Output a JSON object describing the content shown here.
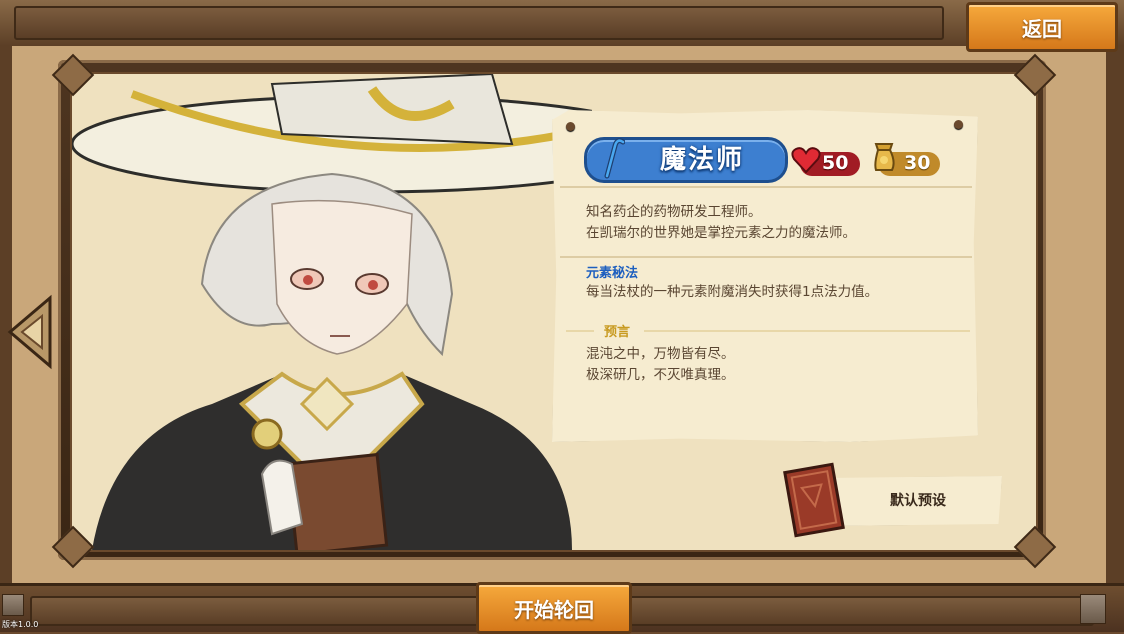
{
  "top": {
    "back_label": "返回"
  },
  "character": {
    "class_name": "魔法师",
    "hp": "50",
    "gold": "30",
    "description_lines": [
      "知名药企的药物研发工程师。",
      "在凯瑞尔的世界她是掌控元素之力的魔法师。"
    ],
    "skill_title": "元素秘法",
    "skill_desc": "每当法杖的一种元素附魔消失时获得1点法力值。",
    "prophecy_title": "预言",
    "prophecy_lines": [
      "混沌之中，万物皆有尽。",
      "极深研几，不灭唯真理。"
    ]
  },
  "preset": {
    "label": "默认预设"
  },
  "bottom": {
    "start_label": "开始轮回",
    "version": "版本1.0.0"
  },
  "colors": {
    "accent_orange": "#e8901f",
    "class_blue": "#3d7fd0",
    "hp_red": "#a11c24",
    "gold": "#c08a2a"
  },
  "icons": [
    "staff-icon",
    "heart-icon",
    "gold-bag-icon",
    "book-icon",
    "left-arrow-icon"
  ]
}
